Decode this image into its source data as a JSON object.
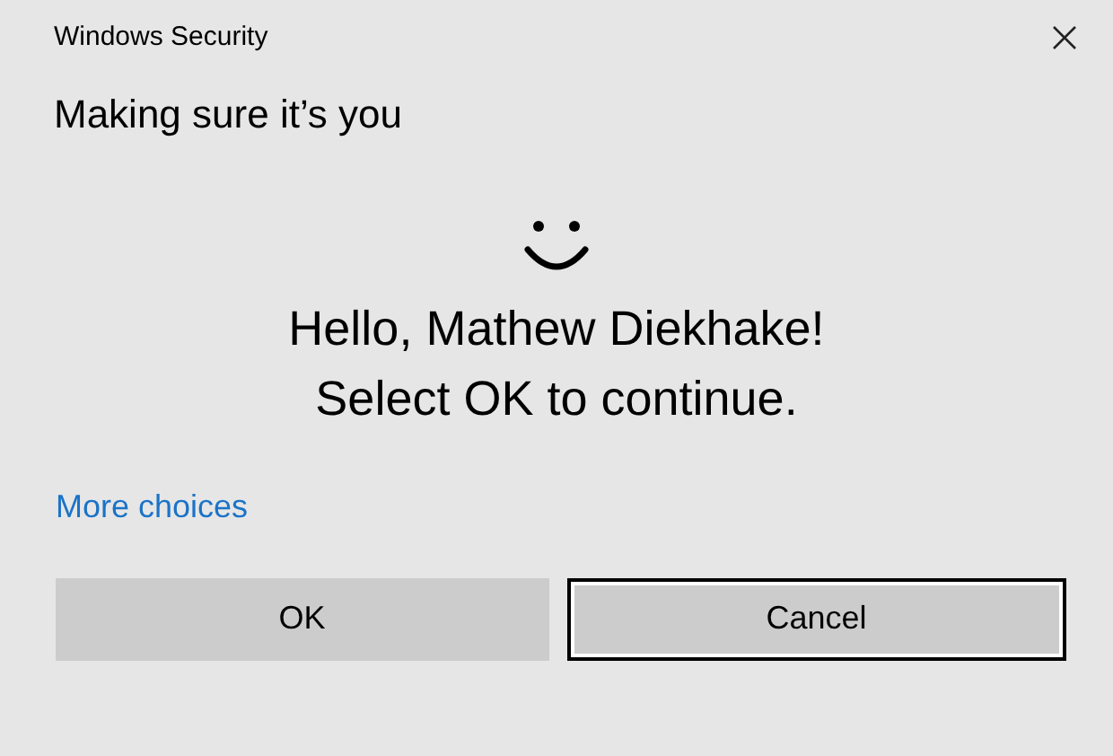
{
  "window": {
    "title": "Windows Security"
  },
  "heading": "Making sure it’s you",
  "message": [
    "Hello, Mathew Diekhake!",
    "Select OK to continue."
  ],
  "link": "More choices",
  "buttons": [
    {
      "label": "OK",
      "focused": false
    },
    {
      "label": "Cancel",
      "focused": true
    }
  ]
}
